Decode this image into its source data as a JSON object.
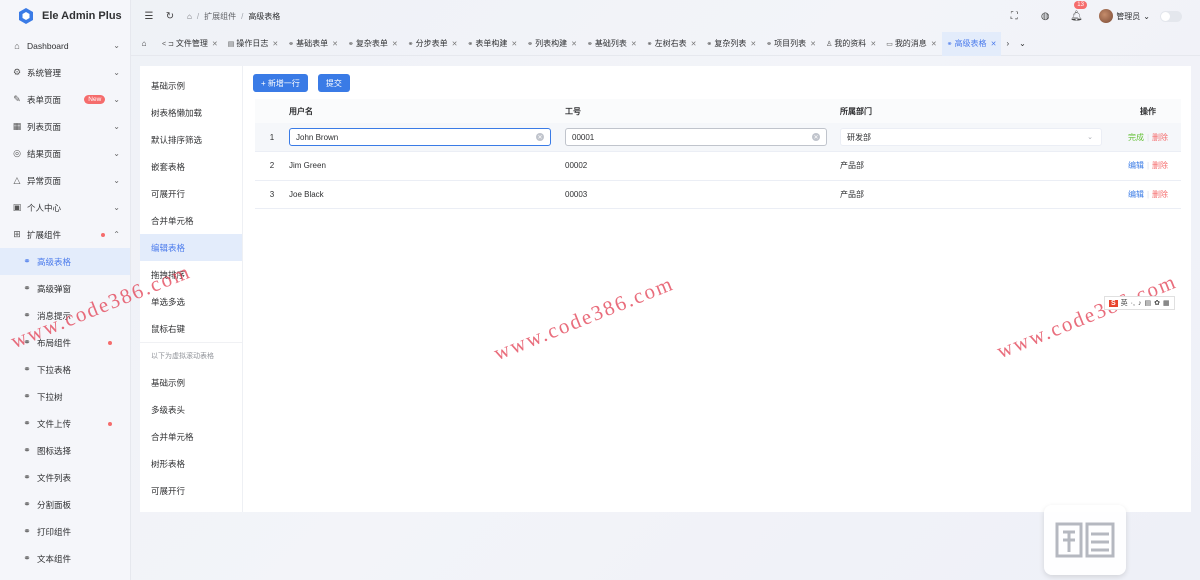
{
  "app": {
    "title": "Ele Admin Plus"
  },
  "sidebar": {
    "items": [
      {
        "label": "Dashboard",
        "icon": "home-icon",
        "chevron": "⌄"
      },
      {
        "label": "系统管理",
        "icon": "settings-icon",
        "chevron": "⌄"
      },
      {
        "label": "表单页面",
        "icon": "form-icon",
        "chevron": "⌄",
        "badge": "New"
      },
      {
        "label": "列表页面",
        "icon": "table-icon",
        "chevron": "⌄"
      },
      {
        "label": "结果页面",
        "icon": "check-circle-icon",
        "chevron": "⌄"
      },
      {
        "label": "异常页面",
        "icon": "warning-icon",
        "chevron": "⌄"
      },
      {
        "label": "个人中心",
        "icon": "user-icon",
        "chevron": "⌄"
      },
      {
        "label": "扩展组件",
        "icon": "extension-icon",
        "chevron": "⌃"
      }
    ],
    "sub_items": [
      {
        "label": "高级表格",
        "active": true
      },
      {
        "label": "高级弹窗"
      },
      {
        "label": "消息提示"
      },
      {
        "label": "布局组件",
        "dot": true
      },
      {
        "label": "下拉表格"
      },
      {
        "label": "下拉树"
      },
      {
        "label": "文件上传",
        "dot": true
      },
      {
        "label": "图标选择"
      },
      {
        "label": "文件列表"
      },
      {
        "label": "分割面板"
      },
      {
        "label": "打印组件"
      },
      {
        "label": "文本组件"
      }
    ]
  },
  "header": {
    "breadcrumb": [
      "扩展组件",
      "高级表格"
    ],
    "sep": "/",
    "notify_count": "13",
    "user_name": "管理员"
  },
  "tabs": [
    {
      "label": "文件管理",
      "icon": "folder-icon",
      "prefix": "< ⊐"
    },
    {
      "label": "操作日志",
      "icon": "calendar-icon"
    },
    {
      "label": "基础表单",
      "icon": "link-icon"
    },
    {
      "label": "复杂表单",
      "icon": "link-icon"
    },
    {
      "label": "分步表单",
      "icon": "link-icon"
    },
    {
      "label": "表单构建",
      "icon": "link-icon"
    },
    {
      "label": "列表构建",
      "icon": "link-icon"
    },
    {
      "label": "基础列表",
      "icon": "link-icon"
    },
    {
      "label": "左树右表",
      "icon": "link-icon"
    },
    {
      "label": "复杂列表",
      "icon": "link-icon"
    },
    {
      "label": "项目列表",
      "icon": "link-icon"
    },
    {
      "label": "我的资料",
      "icon": "user-icon"
    },
    {
      "label": "我的消息",
      "icon": "message-icon"
    },
    {
      "label": "高级表格",
      "icon": "link-icon",
      "active": true
    }
  ],
  "subnav": {
    "items": [
      "基础示例",
      "树表格懒加载",
      "默认排序筛选",
      "嵌套表格",
      "可展开行",
      "合并单元格",
      "编辑表格",
      "拖拽排序",
      "单选多选",
      "鼠标右键"
    ],
    "active_index": 6,
    "group_label": "以下为虚拟滚动表格",
    "group_items": [
      "基础示例",
      "多级表头",
      "合并单元格",
      "树形表格",
      "可展开行"
    ]
  },
  "toolbar": {
    "add_label": "+ 新增一行",
    "submit_label": "提交"
  },
  "table": {
    "columns": [
      "",
      "用户名",
      "工号",
      "所属部门",
      "操作"
    ],
    "rows": [
      {
        "index": "1",
        "username": "John Brown",
        "number": "00001",
        "dept": "研发部",
        "editing": true,
        "actions": [
          "完成",
          "删除"
        ]
      },
      {
        "index": "2",
        "username": "Jim Green",
        "number": "00002",
        "dept": "产品部",
        "actions": [
          "编辑",
          "删除"
        ]
      },
      {
        "index": "3",
        "username": "Joe Black",
        "number": "00003",
        "dept": "产品部",
        "actions": [
          "编辑",
          "删除"
        ]
      }
    ]
  },
  "watermark": {
    "text": "www.code386.com"
  },
  "ime": {
    "label": "英",
    "icon": "S"
  },
  "colors": {
    "accent": "#3a7be6",
    "active_bg": "#e3ecfb",
    "danger": "#f56c6c",
    "success": "#67c23a"
  }
}
